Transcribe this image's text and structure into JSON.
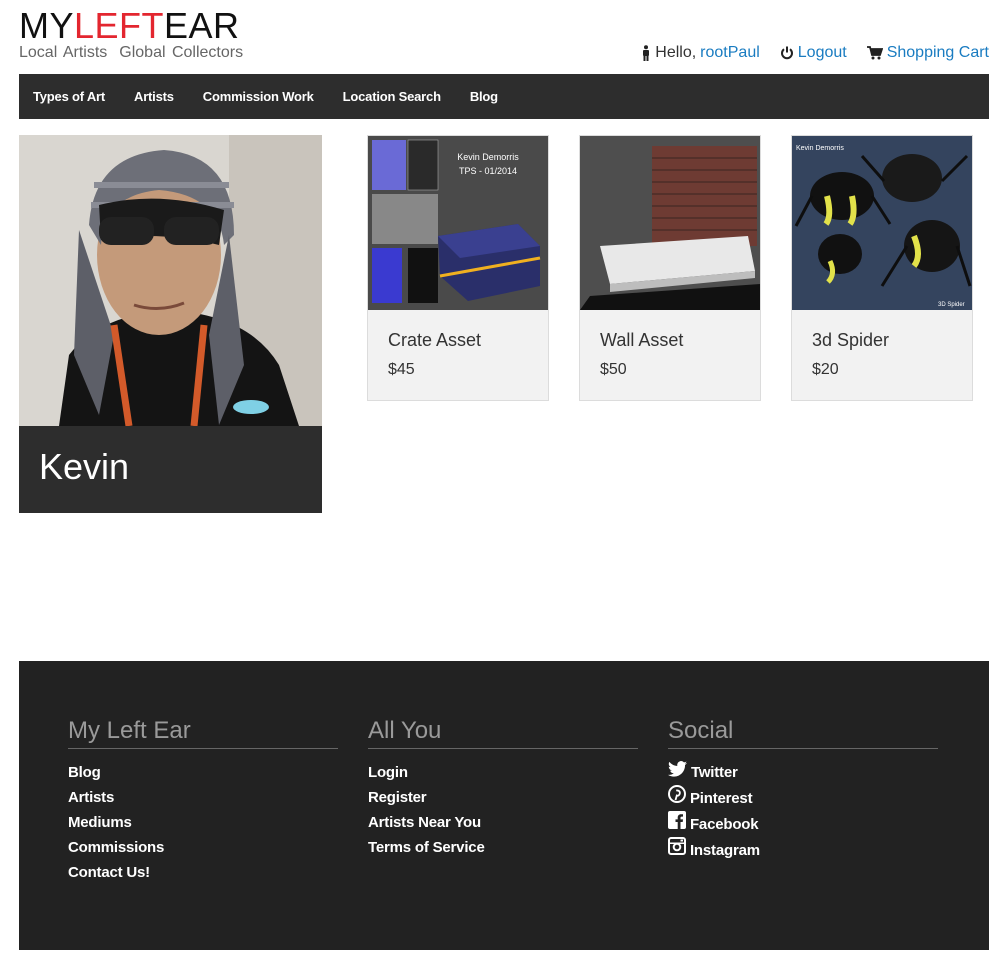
{
  "header": {
    "logo_part1": "MY",
    "logo_part2": "LEFT",
    "logo_part3": "EAR",
    "tagline_1": "Local Artists",
    "tagline_2": "Global Collectors",
    "greeting": "Hello,",
    "username": "rootPaul",
    "logout": "Logout",
    "cart": "Shopping Cart"
  },
  "nav": {
    "items": [
      "Types of Art",
      "Artists",
      "Commission Work",
      "Location Search",
      "Blog"
    ]
  },
  "profile": {
    "name": "Kevin"
  },
  "products": [
    {
      "name": "Crate Asset",
      "price": "$45",
      "caption1": "Kevin  Demorris",
      "caption2": "TPS - 01/2014"
    },
    {
      "name": "Wall Asset",
      "price": "$50"
    },
    {
      "name": "3d Spider",
      "price": "$20",
      "caption1": "Kevin Demorris",
      "caption2": "3D Spider"
    }
  ],
  "footer": {
    "col1": {
      "title": "My Left Ear",
      "links": [
        "Blog",
        "Artists",
        "Mediums",
        "Commissions",
        "Contact Us!"
      ]
    },
    "col2": {
      "title": "All You",
      "links": [
        "Login",
        "Register",
        "Artists Near You",
        "Terms of Service"
      ]
    },
    "col3": {
      "title": "Social",
      "links": [
        {
          "label": "Twitter",
          "icon": "twitter-icon"
        },
        {
          "label": "Pinterest",
          "icon": "pinterest-icon"
        },
        {
          "label": "Facebook",
          "icon": "facebook-icon"
        },
        {
          "label": "Instagram",
          "icon": "instagram-icon"
        }
      ]
    }
  },
  "colors": {
    "accent_red": "#e3262f",
    "link_blue": "#1a7cc1",
    "nav_bg": "#2d2d2d",
    "footer_bg": "#222222"
  }
}
